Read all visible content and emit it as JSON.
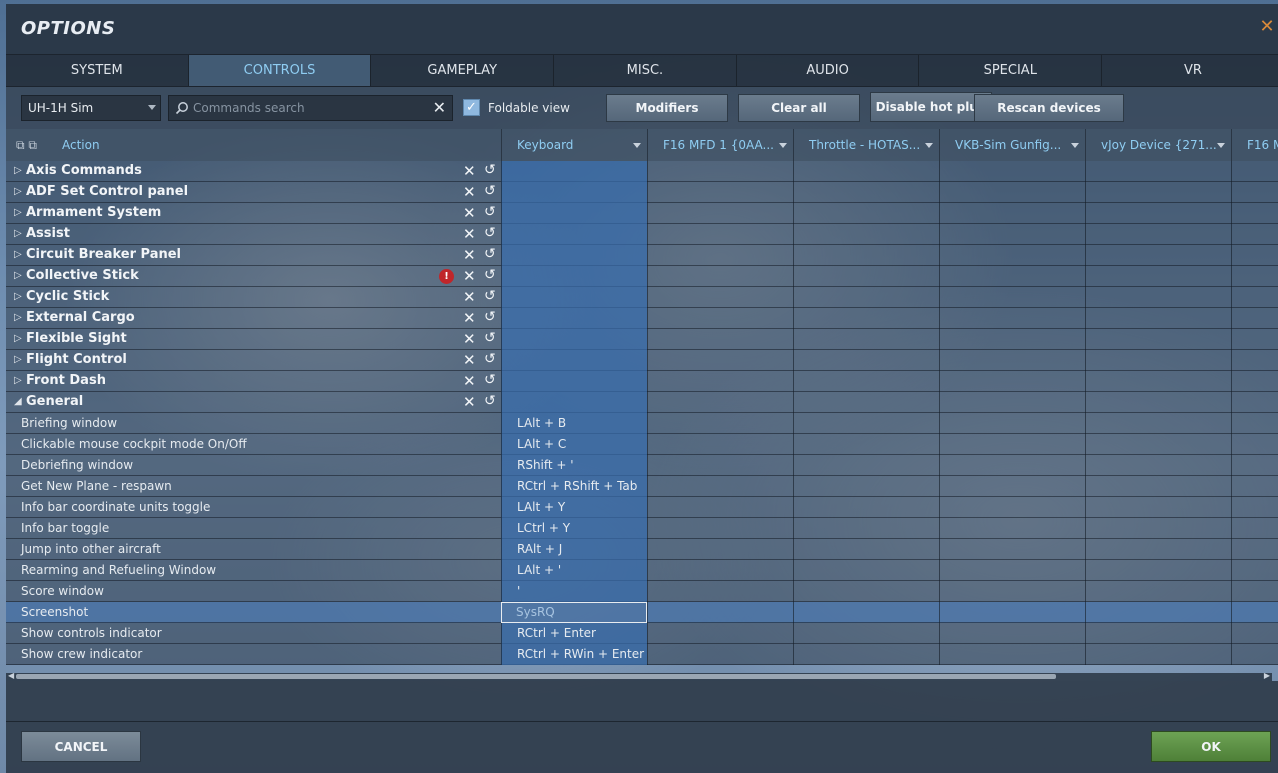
{
  "window": {
    "title": "OPTIONS",
    "close_icon": "close-icon"
  },
  "tabs": [
    {
      "label": "SYSTEM"
    },
    {
      "label": "CONTROLS",
      "active": true
    },
    {
      "label": "GAMEPLAY"
    },
    {
      "label": "MISC."
    },
    {
      "label": "AUDIO"
    },
    {
      "label": "SPECIAL"
    },
    {
      "label": "VR"
    }
  ],
  "toolbar": {
    "aircraft_select": "UH-1H Sim",
    "search_placeholder": "Commands search",
    "foldable_view_label": "Foldable view",
    "foldable_view_checked": true,
    "modifiers_label": "Modifiers",
    "clear_all_label": "Clear all",
    "disable_hot_plug_label": "Disable hot plug",
    "rescan_devices_label": "Rescan devices"
  },
  "grid": {
    "action_header": "Action",
    "columns": [
      {
        "label": "Keyboard"
      },
      {
        "label": "F16 MFD 1 {0AA..."
      },
      {
        "label": "Throttle - HOTAS..."
      },
      {
        "label": "VKB-Sim Gunfig..."
      },
      {
        "label": "vJoy Device {271..."
      },
      {
        "label": "F16 M"
      }
    ],
    "categories": [
      {
        "label": "Axis Commands"
      },
      {
        "label": "ADF Set Control panel"
      },
      {
        "label": "Armament System"
      },
      {
        "label": "Assist"
      },
      {
        "label": "Circuit Breaker Panel"
      },
      {
        "label": "Collective Stick",
        "warning": true
      },
      {
        "label": "Cyclic Stick"
      },
      {
        "label": "External Cargo"
      },
      {
        "label": "Flexible Sight"
      },
      {
        "label": "Flight Control"
      },
      {
        "label": "Front Dash"
      },
      {
        "label": "General",
        "expanded": true
      }
    ],
    "commands": [
      {
        "label": "Briefing window",
        "keyboard": "LAlt + B"
      },
      {
        "label": "Clickable mouse cockpit mode On/Off",
        "keyboard": "LAlt + C"
      },
      {
        "label": "Debriefing window",
        "keyboard": "RShift + '"
      },
      {
        "label": "Get New Plane - respawn",
        "keyboard": "RCtrl + RShift + Tab"
      },
      {
        "label": "Info bar coordinate units toggle",
        "keyboard": "LAlt + Y"
      },
      {
        "label": "Info bar toggle",
        "keyboard": "LCtrl + Y"
      },
      {
        "label": "Jump into other aircraft",
        "keyboard": "RAlt + J"
      },
      {
        "label": "Rearming and Refueling Window",
        "keyboard": "LAlt + '"
      },
      {
        "label": "Score window",
        "keyboard": "'"
      },
      {
        "label": "Screenshot",
        "keyboard": "SysRQ",
        "selected": true
      },
      {
        "label": "Show controls indicator",
        "keyboard": "RCtrl + Enter"
      },
      {
        "label": "Show crew indicator",
        "keyboard": "RCtrl + RWin + Enter"
      }
    ]
  },
  "footer": {
    "cancel_label": "CANCEL",
    "ok_label": "OK"
  },
  "colors": {
    "accent": "#8fcdf2",
    "ok": "#5e9444",
    "warning": "#c0262a",
    "close": "#d9893a"
  }
}
